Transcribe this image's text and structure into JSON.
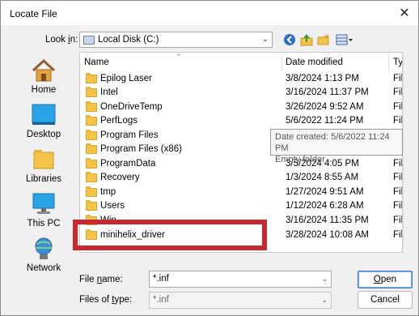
{
  "window": {
    "title": "Locate File",
    "close_glyph": "✕"
  },
  "toolbar": {
    "look_in_label_underlined": "Look ",
    "look_in_label_underlined_char": "i",
    "look_in_label_rest": "n:",
    "location": "Local Disk (C:)",
    "icons": [
      "back-icon",
      "up-folder-icon",
      "new-folder-icon",
      "view-menu-icon"
    ]
  },
  "places": [
    {
      "label": "Home",
      "icon": "home-icon"
    },
    {
      "label": "Desktop",
      "icon": "desktop-icon"
    },
    {
      "label": "Libraries",
      "icon": "libraries-icon"
    },
    {
      "label": "This PC",
      "icon": "this-pc-icon"
    },
    {
      "label": "Network",
      "icon": "network-icon"
    }
  ],
  "columns": {
    "name": "Name",
    "date": "Date modified",
    "type": "Ty"
  },
  "files": [
    {
      "name": "Epilog Laser",
      "date": "3/8/2024 1:13 PM",
      "type": "Fil"
    },
    {
      "name": "Intel",
      "date": "3/16/2024 11:37 PM",
      "type": "Fil"
    },
    {
      "name": "OneDriveTemp",
      "date": "3/26/2024 9:52 AM",
      "type": "Fil"
    },
    {
      "name": "PerfLogs",
      "date": "5/6/2022 11:24 PM",
      "type": "Fil"
    },
    {
      "name": "Program Files",
      "date": "",
      "type": "Fil"
    },
    {
      "name": "Program Files (x86)",
      "date": "",
      "type": "Fil"
    },
    {
      "name": "ProgramData",
      "date": "3/5/2024 4:05 PM",
      "type": "Fil"
    },
    {
      "name": "Recovery",
      "date": "1/3/2024 8:55 AM",
      "type": "Fil"
    },
    {
      "name": "tmp",
      "date": "1/27/2024 9:51 AM",
      "type": "Fil"
    },
    {
      "name": "Users",
      "date": "1/12/2024 6:28 AM",
      "type": "Fil"
    },
    {
      "name": "Win",
      "date": "3/16/2024 11:35 PM",
      "type": "Fil"
    },
    {
      "name": "minihelix_driver",
      "date": "3/28/2024 10:08 AM",
      "type": "Fil"
    }
  ],
  "tooltip": {
    "line1": "Date created: 5/6/2022 11:24 PM",
    "line2": "Empty folder"
  },
  "footer": {
    "file_name_label_pre": "File ",
    "file_name_label_u": "n",
    "file_name_label_post": "ame:",
    "file_name_value": "*.inf",
    "file_type_label_pre": "Files of ",
    "file_type_label_u": "t",
    "file_type_label_post": "ype:",
    "file_type_value": "*.inf",
    "open_label_u": "O",
    "open_label_rest": "pen",
    "cancel_label": "Cancel"
  },
  "colors": {
    "highlight": "#c8282f",
    "folder": "#f3c34a"
  }
}
